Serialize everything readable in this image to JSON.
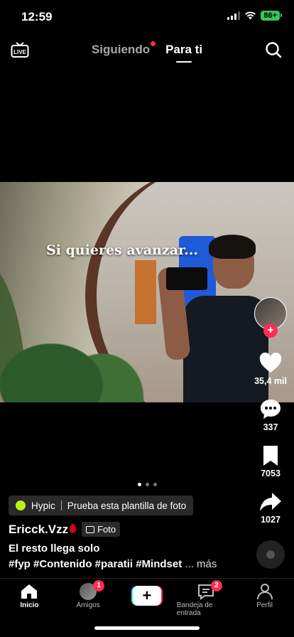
{
  "status_bar": {
    "time": "12:59",
    "battery": "86+"
  },
  "top_nav": {
    "live_icon": "live-tv-icon",
    "tabs": [
      {
        "label": "Siguiendo",
        "active": false,
        "has_dot": true
      },
      {
        "label": "Para ti",
        "active": true
      }
    ],
    "search_icon": "search-icon"
  },
  "post": {
    "caption_overlay": "Si quieres avanzar...",
    "carousel": {
      "total": 3,
      "current": 1
    },
    "effect_name": "Hypic",
    "effect_text": "Prueba esta plantilla de foto",
    "author": "Ericck.Vzz",
    "type_tag": "Foto",
    "title": "El resto llega solo",
    "hashtags": "#fyp #Contenido #paratii #Mindset",
    "more_label": "... más"
  },
  "rail": {
    "likes": "35,4 mil",
    "comments": "337",
    "saves": "7053",
    "shares": "1027"
  },
  "bottom_nav": {
    "items": [
      {
        "label": "Inicio",
        "icon": "home-icon",
        "active": true
      },
      {
        "label": "Amigos",
        "icon": "friends-avatar",
        "badge": "1"
      },
      {
        "label": "",
        "icon": "create-plus-icon"
      },
      {
        "label": "Bandeja de entrada",
        "icon": "inbox-icon",
        "badge": "2"
      },
      {
        "label": "Perfil",
        "icon": "profile-icon"
      }
    ]
  },
  "colors": {
    "accent": "#fe2c55",
    "cyan": "#25f4ee",
    "effect_dot": "#b6f21a"
  }
}
